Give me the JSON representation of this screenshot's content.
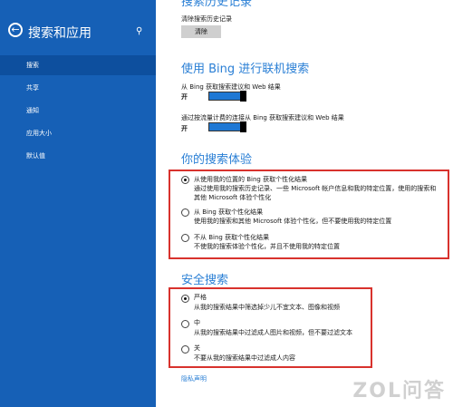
{
  "sidebar": {
    "title": "搜索和应用",
    "items": [
      "搜索",
      "共享",
      "通知",
      "应用大小",
      "默认值"
    ]
  },
  "history": {
    "heading": "搜索历史记录",
    "clear_label": "清除搜索历史记录",
    "clear_button": "清除"
  },
  "bing": {
    "heading": "使用 Bing 进行联机搜索",
    "opt1": "从 Bing 获取搜索建议和 Web 结果",
    "opt1_state": "开",
    "opt2": "通过按流量计费的连接从 Bing 获取搜索建议和 Web 结果",
    "opt2_state": "开"
  },
  "experience": {
    "heading": "你的搜索体验",
    "opts": [
      {
        "title": "从使用我的位置的 Bing 获取个性化结果",
        "line1": "通过使用我的搜索历史记录、一些 Microsoft 帐户信息和我的特定位置，使用的搜索和",
        "line2": "其他 Microsoft 体验个性化",
        "checked": true
      },
      {
        "title": "从 Bing 获取个性化结果",
        "line1": "使用我的搜索和其他 Microsoft 体验个性化，但不要使用我的特定位置",
        "checked": false
      },
      {
        "title": "不从 Bing 获取个性化结果",
        "line1": "不使我的搜索体验个性化，并且不使用我的特定位置",
        "checked": false
      }
    ]
  },
  "safe": {
    "heading": "安全搜索",
    "opts": [
      {
        "title": "严格",
        "desc": "从我的搜索结果中筛选掉少儿不宜文本、图像和视频",
        "checked": true
      },
      {
        "title": "中",
        "desc": "从我的搜索结果中过滤成人图片和视频，但不要过滤文本",
        "checked": false
      },
      {
        "title": "关",
        "desc": "不要从我的搜索结果中过滤成人内容",
        "checked": false
      }
    ]
  },
  "privacy_link": "隐私声明",
  "watermark": "ZOL问答",
  "colors": {
    "sidebar": "#1660b6",
    "accent": "#2a7fd5",
    "highlight": "#d8322d"
  }
}
